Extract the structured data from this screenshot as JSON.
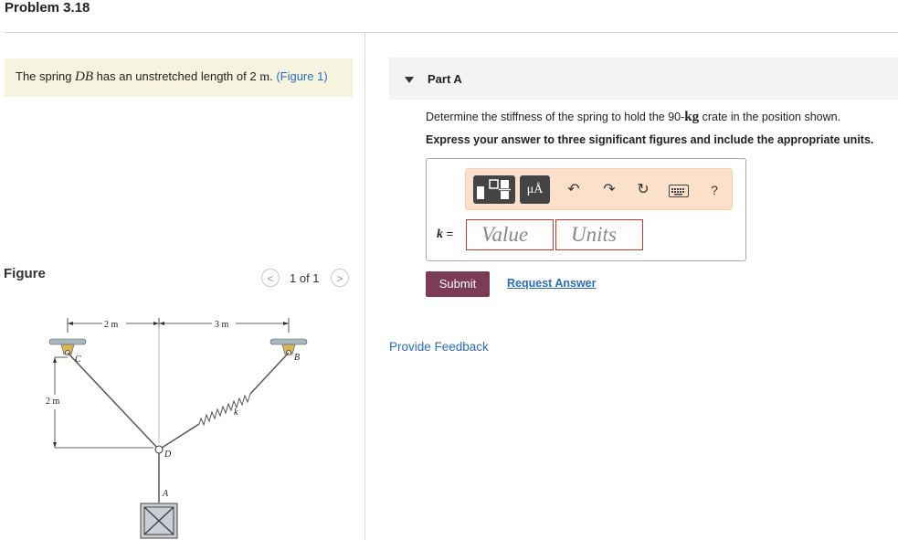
{
  "header": {
    "title": "Problem 3.18"
  },
  "statement": {
    "prefix": "The spring ",
    "spring_name": "DB",
    "middle": " has an unstretched length of 2 ",
    "unit": "m",
    "end": ". ",
    "figure_link": "(Figure 1)"
  },
  "figure": {
    "heading": "Figure",
    "pager": {
      "prev_icon": "chevron-left-icon",
      "next_icon": "chevron-right-icon",
      "label": "1 of 1"
    },
    "labels": {
      "dim_left": "2 m",
      "dim_right": "3 m",
      "dim_vertical": "2 m",
      "point_c": "C",
      "point_b": "B",
      "point_d": "D",
      "point_a": "A",
      "spring_k": "k"
    }
  },
  "part": {
    "label": "Part A",
    "question_pre": "Determine the stiffness of the spring to hold the 90-",
    "question_unit": "kg",
    "question_post": " crate in the position shown.",
    "instruction": "Express your answer to three significant figures and include the appropriate units.",
    "toolbar": {
      "template_icon": "fraction-template-icon",
      "units_label": "μÅ",
      "undo_icon": "undo-icon",
      "redo_icon": "redo-icon",
      "reset_icon": "reset-icon",
      "keyboard_icon": "keyboard-icon",
      "help_label": "?"
    },
    "answer": {
      "variable": "k",
      "equals": " =",
      "value_placeholder": "Value",
      "units_placeholder": "Units"
    },
    "submit_label": "Submit",
    "request_answer_label": "Request Answer"
  },
  "feedback": {
    "label": "Provide Feedback"
  },
  "colors": {
    "statement_bg": "#f6f4de",
    "link": "#2a6ebb",
    "submit": "#7d3c56",
    "toolbar_bg": "#fbe1cb",
    "field_border": "#c0392b"
  }
}
